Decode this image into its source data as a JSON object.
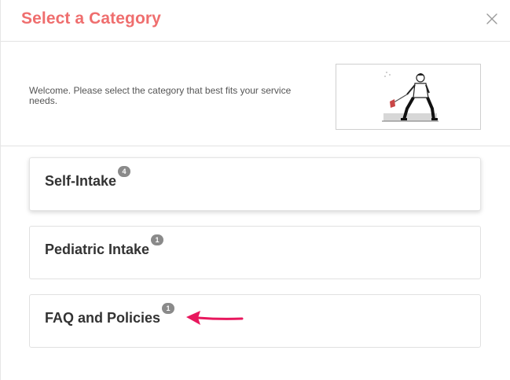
{
  "modal": {
    "title": "Select a Category",
    "close_icon": "close-icon"
  },
  "intro": {
    "text": "Welcome. Please select the category that best fits your service needs.",
    "image_icon": "illustration-person-digging"
  },
  "categories": [
    {
      "label": "Self-Intake",
      "count": "4"
    },
    {
      "label": "Pediatric Intake",
      "count": "1"
    },
    {
      "label": "FAQ and Policies",
      "count": "1"
    }
  ],
  "colors": {
    "title": "#ef6e6e",
    "badge": "#8a8a8a",
    "annotation_arrow": "#e8175d"
  }
}
